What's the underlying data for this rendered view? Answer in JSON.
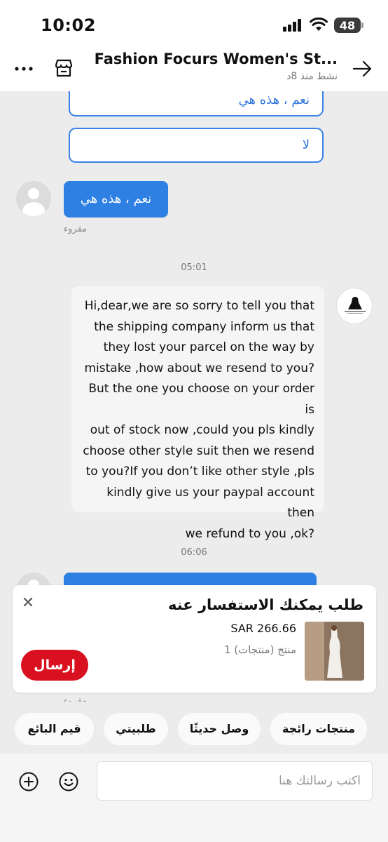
{
  "status_bar": {
    "time": "10:02",
    "battery": "48"
  },
  "header": {
    "shop_name": "Fashion Focurs Women's St...",
    "status": "نشط منذ 8د"
  },
  "chat": {
    "option_partial": "نعم ، هذه هي",
    "option_no": "لا",
    "sent_message": "نعم ، هذه هي",
    "read_label": "مقروء",
    "time_1": "05:01",
    "shop_message_lines": [
      "Hi,dear,we are so sorry to tell you that",
      "the shipping company inform us that",
      "they lost your parcel on the way by",
      "mistake ,how about we resend to you?",
      "But the one you choose on your order is",
      "out of stock now ,could you pls kindly",
      "choose other style suit then we resend",
      "to you?If you don’t like other style ,pls",
      "kindly give us your paypal account then",
      "we refund to you ,ok?"
    ],
    "time_2": "06:06",
    "read_label_2": "مقروء"
  },
  "inquiry": {
    "title": "طلب يمكنك الاستفسار عنه",
    "price": "SAR 266.66",
    "quantity": "1 منتج (منتجات)",
    "send": "إرسال"
  },
  "chips": [
    "منتجات رائجة",
    "وصل حديثًا",
    "طلبيتي",
    "قيم البائع"
  ],
  "input": {
    "placeholder": "اكتب رسالتك هنا"
  },
  "colors": {
    "accent_blue": "#2f80e3",
    "send_red": "#d8101f"
  }
}
